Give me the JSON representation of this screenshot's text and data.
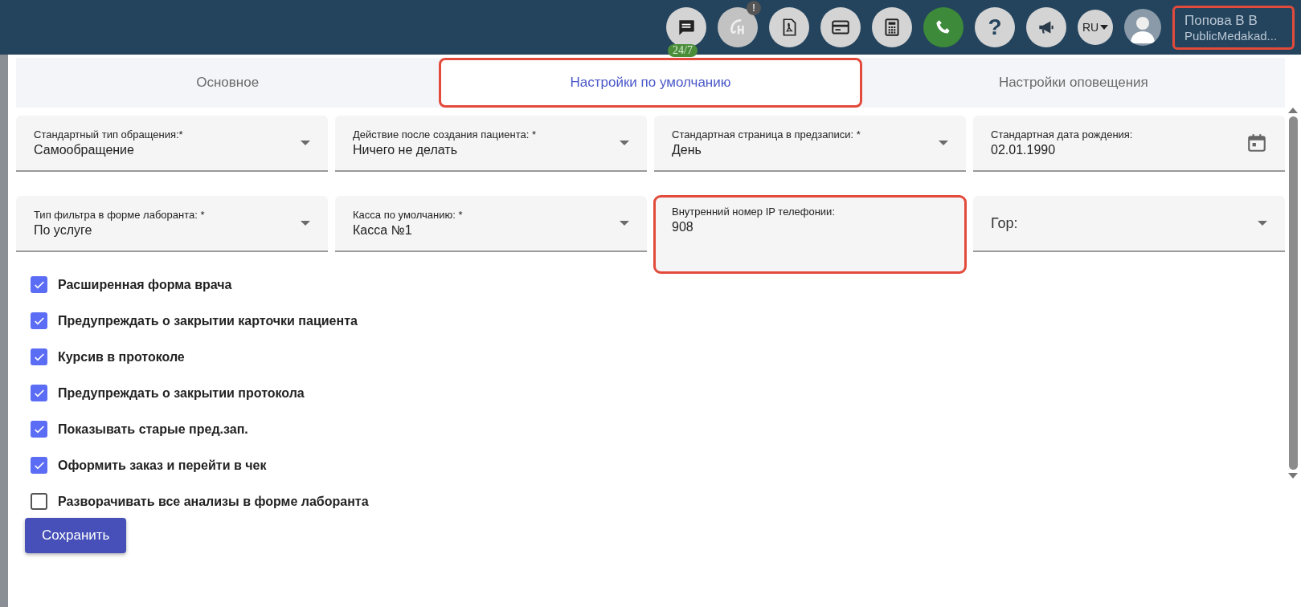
{
  "header": {
    "tools": [
      {
        "kind": "chat",
        "badge": "24/7",
        "active": true
      },
      {
        "kind": "signature",
        "alert": "!",
        "active": false
      },
      {
        "kind": "pdf",
        "active": true
      },
      {
        "kind": "card",
        "active": true
      },
      {
        "kind": "calculator",
        "active": true
      },
      {
        "kind": "phone",
        "active": true
      },
      {
        "kind": "help",
        "glyph": "?",
        "active": true
      },
      {
        "kind": "megaphone",
        "active": true
      }
    ],
    "language": "RU",
    "user": {
      "name": "Попова В В",
      "org": "PublicMedakad...",
      "highlighted": true
    }
  },
  "tabs": [
    {
      "label": "Основное",
      "selected": false,
      "highlighted": false
    },
    {
      "label": "Настройки по умолчанию",
      "selected": true,
      "highlighted": true
    },
    {
      "label": "Настройки оповещения",
      "selected": false,
      "highlighted": false
    }
  ],
  "fields": [
    {
      "kind": "select",
      "label": "Стандартный тип обращения:*",
      "value": "Самообращение",
      "highlighted": false
    },
    {
      "kind": "select",
      "label": "Действие после создания пациента: *",
      "value": "Ничего не делать",
      "highlighted": false
    },
    {
      "kind": "select",
      "label": "Стандартная страница в предзаписи: *",
      "value": "День",
      "highlighted": false
    },
    {
      "kind": "date",
      "label": "Стандартная дата рождения:",
      "value": "02.01.1990",
      "highlighted": false
    },
    {
      "kind": "select",
      "label": "Тип фильтра в форме лаборанта: *",
      "value": "По услуге",
      "highlighted": false
    },
    {
      "kind": "select",
      "label": "Касса по умолчанию: *",
      "value": "Касса №1",
      "highlighted": false
    },
    {
      "kind": "text",
      "label": "Внутренний номер IP телефонии:",
      "value": "908",
      "highlighted": true
    },
    {
      "kind": "select",
      "label": "Гор:",
      "highlighted": false
    }
  ],
  "options": [
    {
      "label": "Расширенная форма врача",
      "checked": true
    },
    {
      "label": "Предупреждать о закрытии карточки пациента",
      "checked": true
    },
    {
      "label": "Курсив в протоколе",
      "checked": true
    },
    {
      "label": "Предупреждать о закрытии протокола",
      "checked": true
    },
    {
      "label": "Показывать старые пред.зап.",
      "checked": true
    },
    {
      "label": "Оформить заказ и перейти в чек",
      "checked": true
    },
    {
      "label": "Разворачивать все анализы в форме лаборанта",
      "checked": false
    }
  ],
  "save_button": "Сохранить"
}
